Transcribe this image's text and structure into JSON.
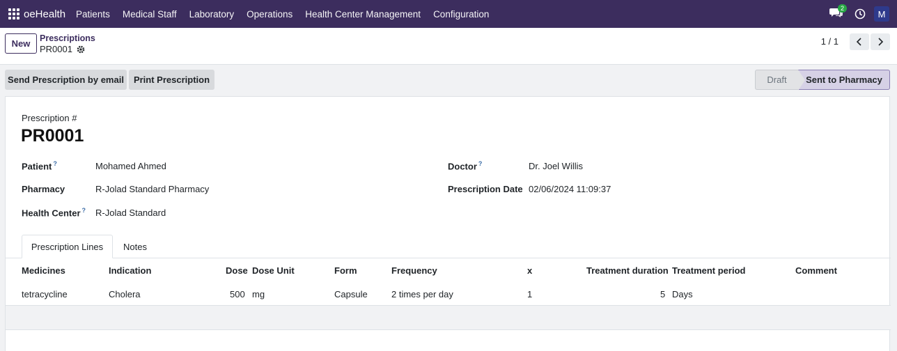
{
  "nav": {
    "brand": "oeHealth",
    "menu": [
      "Patients",
      "Medical Staff",
      "Laboratory",
      "Operations",
      "Health Center Management",
      "Configuration"
    ],
    "chat_badge": "2",
    "avatar_letter": "M"
  },
  "control": {
    "new_label": "New",
    "breadcrumb": "Prescriptions",
    "record": "PR0001",
    "pager": "1 / 1"
  },
  "actions": {
    "send_email": "Send Prescription by email",
    "print": "Print Prescription"
  },
  "stages": {
    "draft": "Draft",
    "sent": "Sent to Pharmacy"
  },
  "form": {
    "number_label": "Prescription #",
    "number": "PR0001",
    "patient_label": "Patient",
    "patient": "Mohamed Ahmed",
    "pharmacy_label": "Pharmacy",
    "pharmacy": "R-Jolad Standard Pharmacy",
    "health_center_label": "Health Center",
    "health_center": "R-Jolad Standard",
    "doctor_label": "Doctor",
    "doctor": "Dr. Joel Willis",
    "date_label": "Prescription Date",
    "date": "02/06/2024 11:09:37",
    "help_mark": "?"
  },
  "tabs": [
    "Prescription Lines",
    "Notes"
  ],
  "lines": {
    "headers": [
      "Medicines",
      "Indication",
      "Dose",
      "Dose Unit",
      "Form",
      "Frequency",
      "x",
      "Treatment duration",
      "Treatment period",
      "Comment"
    ],
    "rows": [
      {
        "medicine": "tetracycline",
        "indication": "Cholera",
        "dose": "500",
        "unit": "mg",
        "form": "Capsule",
        "frequency": "2 times per day",
        "x": "1",
        "duration": "5",
        "period": "Days",
        "comment": ""
      }
    ]
  },
  "colors": {
    "nav_bg": "#3c2d5e",
    "accent": "#3c2d5e",
    "stage_active_bg": "#d6d1e6"
  }
}
